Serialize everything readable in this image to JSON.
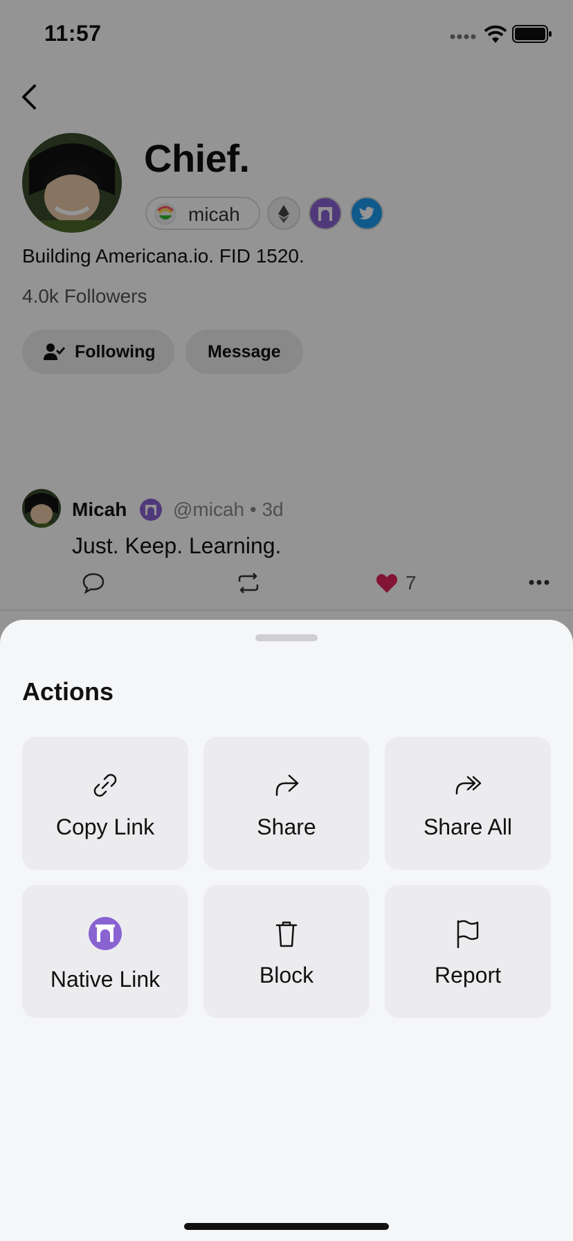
{
  "status_bar": {
    "time": "11:57"
  },
  "profile": {
    "display_name": "Chief.",
    "username_pill": "micah",
    "bio": "Building Americana.io. FID 1520.",
    "followers": "4.0k Followers",
    "following_button": "Following",
    "message_button": "Message",
    "badges": [
      "ethereum-icon",
      "farcaster-icon",
      "twitter-icon"
    ]
  },
  "post": {
    "author": "Micah",
    "handle_time": "@micah • 3d",
    "text": "Just. Keep. Learning.",
    "like_count": "7"
  },
  "sheet": {
    "title": "Actions",
    "actions": [
      {
        "label": "Copy Link",
        "icon": "link-icon"
      },
      {
        "label": "Share",
        "icon": "share-icon"
      },
      {
        "label": "Share All",
        "icon": "share-all-icon"
      },
      {
        "label": "Native Link",
        "icon": "farcaster-icon"
      },
      {
        "label": "Block",
        "icon": "trash-icon"
      },
      {
        "label": "Report",
        "icon": "flag-icon"
      }
    ]
  },
  "colors": {
    "farcaster": "#8a63d2",
    "twitter": "#1d9bf0",
    "like": "#e0245e"
  }
}
